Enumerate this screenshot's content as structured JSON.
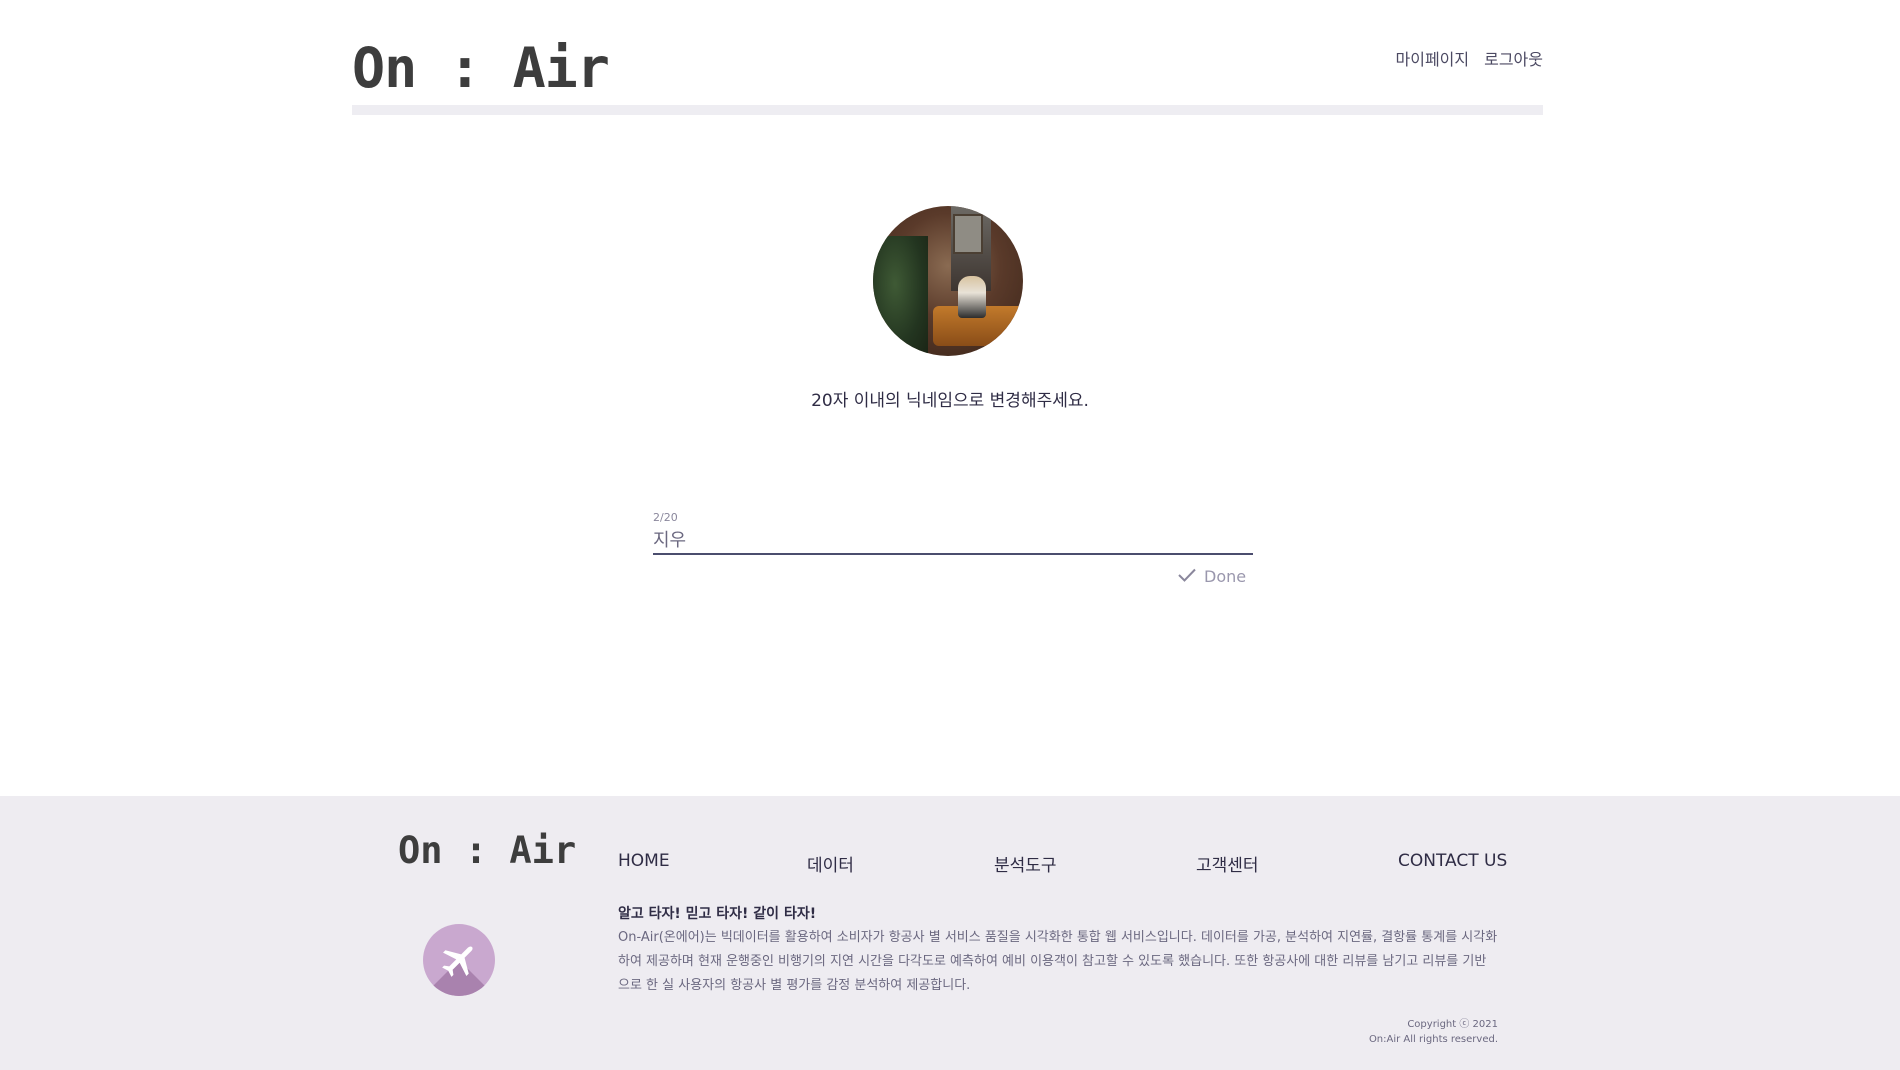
{
  "header": {
    "logo": "On : Air",
    "links": {
      "mypage": "마이페이지",
      "logout": "로그아웃"
    }
  },
  "profile": {
    "notice": "20자 이내의 닉네임으로 변경해주세요.",
    "nickname": {
      "counter": "2/20",
      "value": "지우"
    },
    "done_label": "Done"
  },
  "footer": {
    "logo": "On : Air",
    "nav": {
      "home": "HOME",
      "data": "데이터",
      "tools": "분석도구",
      "support": "고객센터",
      "contact": "CONTACT US"
    },
    "slogan": "알고 타자! 믿고 타자! 같이 타자!",
    "description": "On-Air(온에어)는 빅데이터를 활용하여 소비자가 항공사 별 서비스 품질을 시각화한 통합 웹 서비스입니다. 데이터를 가공, 분석하여 지연률, 결항률 통계를 시각화하여 제공하며 현재 운행중인 비행기의 지연 시간을 다각도로 예측하여 예비 이용객이 참고할 수 있도록 했습니다. 또한 항공사에 대한 리뷰를 남기고 리뷰를 기반으로 한 실 사용자의 항공사 별 평가를 감정 분석하여 제공합니다.",
    "copyright": "Copyright ⓒ 2021",
    "rights": "On:Air All rights reserved."
  },
  "icons": {
    "plane": "airplane-icon",
    "check": "check-icon"
  },
  "colors": {
    "header_bar": "#eeedf2",
    "footer_bg": "#eeecf1",
    "accent": "#4b4d6e",
    "plane_bg": "#c9a8cf"
  }
}
